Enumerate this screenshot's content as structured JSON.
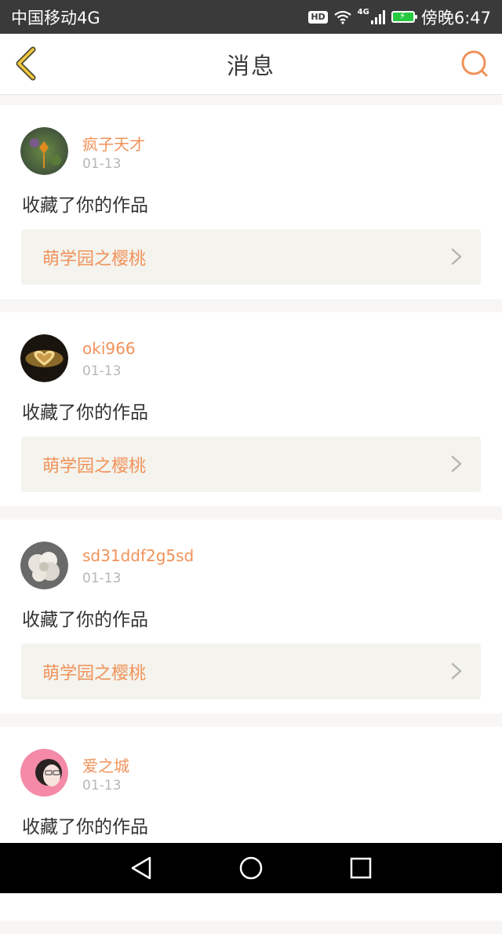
{
  "status_bar": {
    "carrier": "中国移动4G",
    "hd": "HD",
    "network": "4G",
    "time": "傍晚6:47"
  },
  "header": {
    "title": "消息",
    "back_icon": "chevron-left-icon",
    "search_icon": "search-icon"
  },
  "colors": {
    "accent": "#f0925a",
    "back_icon": "#f5c842",
    "link_bg": "#f4f3ed",
    "separator": "#f8f6f5"
  },
  "notifications": [
    {
      "username": "疯子天才",
      "date": "01-13",
      "action": "收藏了你的作品",
      "work_title": "萌学园之樱桃"
    },
    {
      "username": "oki966",
      "date": "01-13",
      "action": "收藏了你的作品",
      "work_title": "萌学园之樱桃"
    },
    {
      "username": "sd31ddf2g5sd",
      "date": "01-13",
      "action": "收藏了你的作品",
      "work_title": "萌学园之樱桃"
    },
    {
      "username": "爱之城",
      "date": "01-13",
      "action": "收藏了你的作品",
      "work_title": ""
    }
  ],
  "nav_bar": {
    "back": "triangle-back-icon",
    "home": "circle-home-icon",
    "recents": "square-recents-icon"
  }
}
